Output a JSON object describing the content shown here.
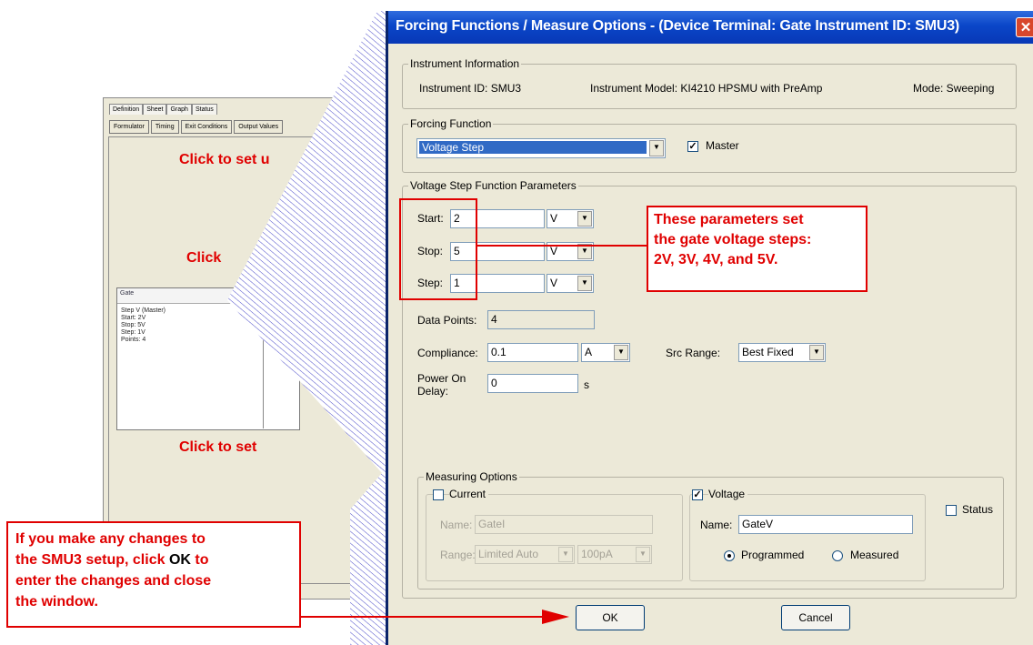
{
  "background_window": {
    "tabs": [
      "Definition",
      "Sheet",
      "Graph",
      "Status"
    ],
    "subtabs": [
      "Formulator",
      "Timing",
      "Exit Conditions",
      "Output Values"
    ],
    "box_header": "Gate",
    "box_lines": [
      "Step V (Master)",
      "Start: 2V",
      "Stop: 5V",
      "Step: 1V",
      "Points: 4"
    ],
    "click_texts": [
      "Click to set u",
      "Click",
      "Click to set"
    ]
  },
  "dialog": {
    "title": "Forcing Functions / Measure Options - (Device Terminal: Gate  Instrument ID: SMU3)",
    "close_glyph": "✕",
    "instrument_info": {
      "legend": "Instrument Information",
      "id_text": "Instrument ID:  SMU3",
      "model_text": "Instrument Model:  KI4210 HPSMU with PreAmp",
      "mode_text": "Mode:  Sweeping"
    },
    "forcing_function": {
      "legend": "Forcing Function",
      "selected": "Voltage Step",
      "master_label": "Master",
      "master_checked": true
    },
    "params": {
      "legend": "Voltage Step Function Parameters",
      "start_label": "Start:",
      "start_value": "2",
      "start_unit": "V",
      "stop_label": "Stop:",
      "stop_value": "5",
      "stop_unit": "V",
      "step_label": "Step:",
      "step_value": "1",
      "step_unit": "V",
      "data_points_label": "Data Points:",
      "data_points_value": "4",
      "compliance_label": "Compliance:",
      "compliance_value": "0.1",
      "compliance_unit": "A",
      "src_range_label": "Src Range:",
      "src_range_value": "Best Fixed",
      "power_on_label_1": "Power On",
      "power_on_label_2": "Delay:",
      "power_on_value": "0",
      "power_on_unit": "s"
    },
    "measuring": {
      "legend": "Measuring Options",
      "current_label": "Current",
      "current_checked": false,
      "current_name_label": "Name:",
      "current_name_value": "GateI",
      "current_range_label": "Range:",
      "current_range_value": "Limited Auto",
      "current_range2_value": "100pA",
      "voltage_label": "Voltage",
      "voltage_checked": true,
      "voltage_name_label": "Name:",
      "voltage_name_value": "GateV",
      "programmed_label": "Programmed",
      "measured_label": "Measured",
      "status_label": "Status"
    },
    "ok_label": "OK",
    "cancel_label": "Cancel"
  },
  "annotations": {
    "params_note": [
      "These parameters set",
      "the gate voltage steps:",
      "2V, 3V, 4V, and 5V."
    ],
    "ok_note_1": "If you make any changes to",
    "ok_note_2a": "the SMU3 setup, click ",
    "ok_note_2b": "OK",
    "ok_note_2c": " to",
    "ok_note_3": "enter the changes and close",
    "ok_note_4": "the window."
  },
  "colors": {
    "annotation_red": "#e00000",
    "title_blue": "#0a46c8",
    "dialog_bg": "#ece9d8"
  }
}
